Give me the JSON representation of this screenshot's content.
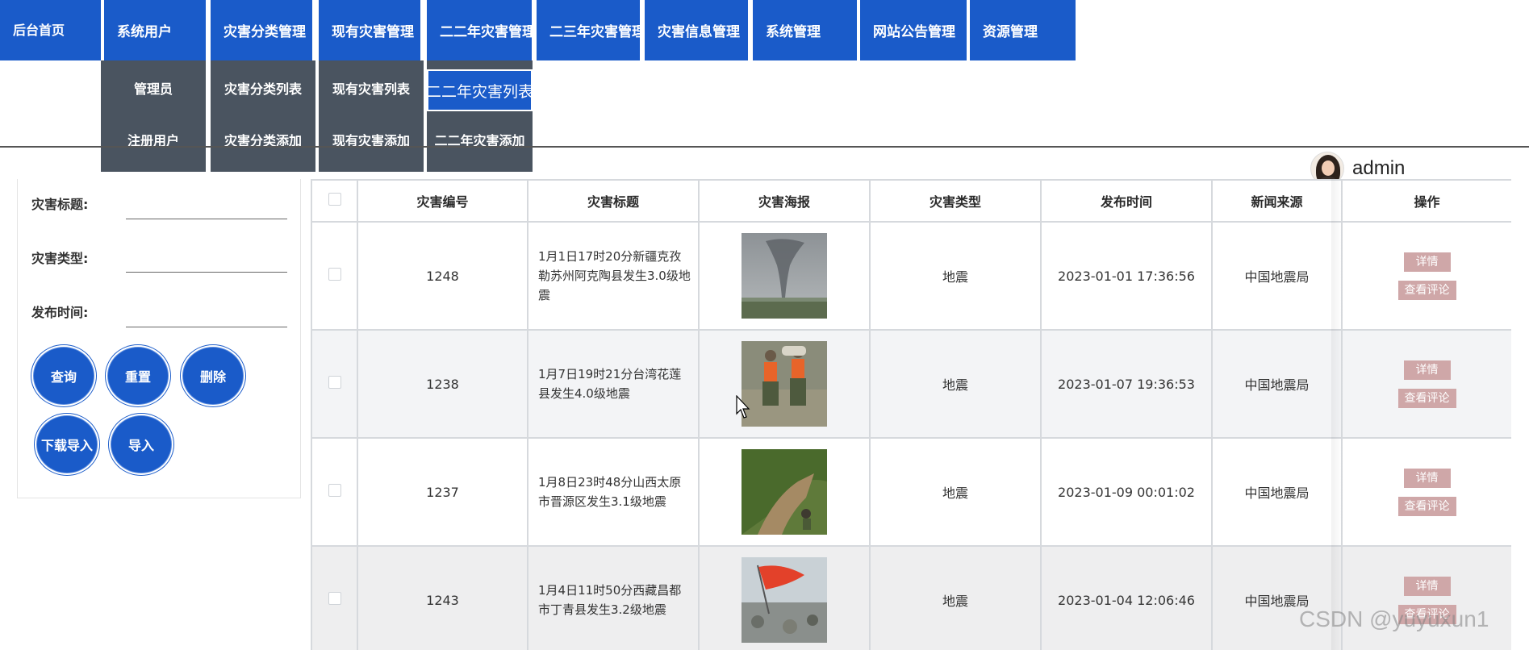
{
  "nav": {
    "items": [
      "后台首页",
      "系统用户",
      "灾害分类管理",
      "现有灾害管理",
      "二二年灾害管理",
      "二三年灾害管理",
      "灾害信息管理",
      "系统管理",
      "网站公告管理",
      "资源管理"
    ]
  },
  "dropdowns": {
    "user": [
      "管理员",
      "注册用户"
    ],
    "category": [
      "灾害分类列表",
      "灾害分类添加"
    ],
    "current": [
      "现有灾害列表",
      "现有灾害添加"
    ],
    "y2022": [
      "二二年灾害列表",
      "二二年灾害添加"
    ]
  },
  "user": {
    "name": "admin"
  },
  "search": {
    "title_label": "灾害标题:",
    "type_label": "灾害类型:",
    "time_label": "发布时间:",
    "title_value": "",
    "type_value": "",
    "time_value": "",
    "buttons": {
      "query": "查询",
      "reset": "重置",
      "delete": "删除",
      "download": "下载导入",
      "import": "导入"
    }
  },
  "table": {
    "headers": [
      "灾害编号",
      "灾害标题",
      "灾害海报",
      "灾害类型",
      "发布时间",
      "新闻来源",
      "操作"
    ],
    "rows": [
      {
        "id": "1248",
        "title": "1月1日17时20分新疆克孜勒苏州阿克陶县发生3.0级地震",
        "poster": "tornado-photo",
        "type": "地震",
        "time": "2023-01-01 17:36:56",
        "source": "中国地震局",
        "detail": "详情",
        "comment": "查看评论"
      },
      {
        "id": "1238",
        "title": "1月7日19时21分台湾花莲县发生4.0级地震",
        "poster": "flood-rescue-photo",
        "type": "地震",
        "time": "2023-01-07 19:36:53",
        "source": "中国地震局",
        "detail": "详情",
        "comment": "查看评论"
      },
      {
        "id": "1237",
        "title": "1月8日23时48分山西太原市晋源区发生3.1级地震",
        "poster": "landslide-photo",
        "type": "地震",
        "time": "2023-01-09 00:01:02",
        "source": "中国地震局",
        "detail": "详情",
        "comment": "查看评论"
      },
      {
        "id": "1243",
        "title": "1月4日11时50分西藏昌都市丁青县发生3.2级地震",
        "poster": "flag-rescue-photo",
        "type": "地震",
        "time": "2023-01-04 12:06:46",
        "source": "中国地震局",
        "detail": "详情",
        "comment": "查看评论"
      }
    ]
  },
  "watermark": "CSDN @yuyuxun1"
}
